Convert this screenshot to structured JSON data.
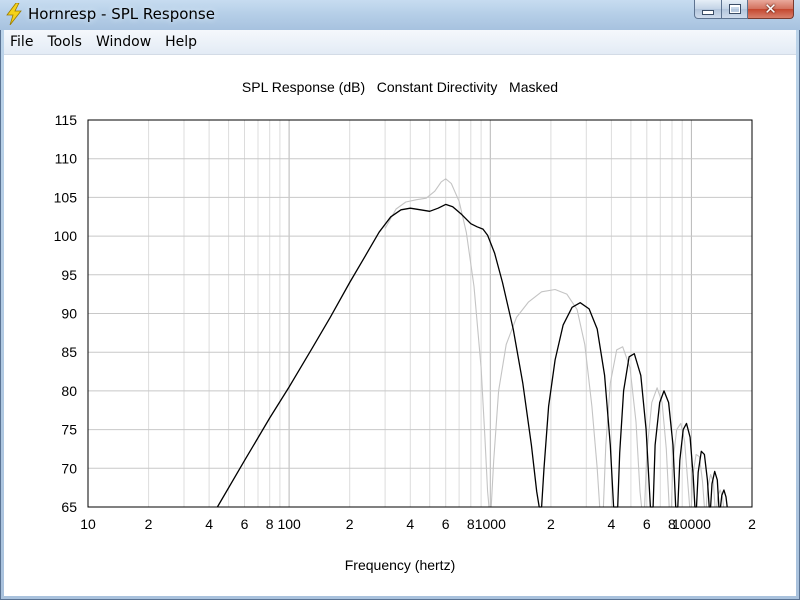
{
  "window": {
    "title": "Hornresp - SPL Response",
    "buttons": {
      "minimize": "minimize",
      "maximize": "maximize",
      "close": "✕"
    },
    "icon": "lightning-bolt-icon"
  },
  "menu": {
    "items": [
      {
        "label": "File"
      },
      {
        "label": "Tools"
      },
      {
        "label": "Window"
      },
      {
        "label": "Help"
      }
    ]
  },
  "chart_data": {
    "type": "line",
    "title": "SPL Response (dB)   Constant Directivity   Masked",
    "xlabel": "Frequency (hertz)",
    "ylabel": "",
    "x_scale": "log",
    "xlim": [
      10,
      20000
    ],
    "ylim": [
      65,
      115
    ],
    "yticks": [
      65,
      70,
      75,
      80,
      85,
      90,
      95,
      100,
      105,
      110,
      115
    ],
    "xtick_labels": [
      {
        "x": 10,
        "label": "10"
      },
      {
        "x": 20,
        "label": "2"
      },
      {
        "x": 40,
        "label": "4"
      },
      {
        "x": 60,
        "label": "6"
      },
      {
        "x": 80,
        "label": "8"
      },
      {
        "x": 100,
        "label": "100"
      },
      {
        "x": 200,
        "label": "2"
      },
      {
        "x": 400,
        "label": "4"
      },
      {
        "x": 600,
        "label": "6"
      },
      {
        "x": 800,
        "label": "8"
      },
      {
        "x": 1000,
        "label": "1000"
      },
      {
        "x": 2000,
        "label": "2"
      },
      {
        "x": 4000,
        "label": "4"
      },
      {
        "x": 6000,
        "label": "6"
      },
      {
        "x": 8000,
        "label": "8"
      },
      {
        "x": 10000,
        "label": "10000"
      },
      {
        "x": 20000,
        "label": "2"
      }
    ],
    "grid": true,
    "legend": "none",
    "series": [
      {
        "color": "#000000",
        "points": [
          [
            44,
            65
          ],
          [
            60,
            71
          ],
          [
            80,
            76.5
          ],
          [
            100,
            80.5
          ],
          [
            130,
            85.5
          ],
          [
            160,
            89.5
          ],
          [
            200,
            94
          ],
          [
            240,
            97.5
          ],
          [
            280,
            100.5
          ],
          [
            320,
            102.5
          ],
          [
            360,
            103.4
          ],
          [
            400,
            103.6
          ],
          [
            450,
            103.4
          ],
          [
            500,
            103.2
          ],
          [
            550,
            103.6
          ],
          [
            600,
            104.1
          ],
          [
            650,
            103.8
          ],
          [
            720,
            102.8
          ],
          [
            800,
            101.6
          ],
          [
            860,
            101.2
          ],
          [
            920,
            100.9
          ],
          [
            970,
            100.1
          ],
          [
            1050,
            97.8
          ],
          [
            1150,
            94
          ],
          [
            1300,
            88
          ],
          [
            1450,
            81
          ],
          [
            1600,
            73
          ],
          [
            1700,
            67
          ],
          [
            1750,
            65
          ],
          [
            1800,
            65
          ],
          [
            1850,
            70
          ],
          [
            1950,
            78
          ],
          [
            2100,
            84
          ],
          [
            2300,
            88.5
          ],
          [
            2550,
            90.8
          ],
          [
            2800,
            91.4
          ],
          [
            3100,
            90.6
          ],
          [
            3400,
            88
          ],
          [
            3700,
            82
          ],
          [
            3950,
            73
          ],
          [
            4100,
            65
          ],
          [
            4300,
            65
          ],
          [
            4400,
            72
          ],
          [
            4600,
            80
          ],
          [
            4900,
            84.4
          ],
          [
            5200,
            84.8
          ],
          [
            5600,
            82
          ],
          [
            5950,
            75
          ],
          [
            6250,
            65
          ],
          [
            6450,
            65
          ],
          [
            6600,
            73
          ],
          [
            6950,
            78.5
          ],
          [
            7300,
            80
          ],
          [
            7700,
            78.5
          ],
          [
            8100,
            73
          ],
          [
            8350,
            65
          ],
          [
            8550,
            65
          ],
          [
            8750,
            71
          ],
          [
            9100,
            75
          ],
          [
            9450,
            75.8
          ],
          [
            9850,
            74
          ],
          [
            10200,
            69
          ],
          [
            10400,
            65
          ],
          [
            10600,
            65
          ],
          [
            10800,
            69.5
          ],
          [
            11200,
            72.2
          ],
          [
            11600,
            71.8
          ],
          [
            12000,
            68.5
          ],
          [
            12250,
            65
          ],
          [
            12450,
            65
          ],
          [
            12650,
            68
          ],
          [
            13050,
            69.6
          ],
          [
            13450,
            68.5
          ],
          [
            13700,
            65
          ],
          [
            13950,
            65
          ],
          [
            14150,
            66.5
          ],
          [
            14500,
            67.2
          ],
          [
            14850,
            66.3
          ],
          [
            15050,
            65
          ]
        ]
      },
      {
        "color": "#c4c4c4",
        "points": [
          [
            300,
            101
          ],
          [
            340,
            103.5
          ],
          [
            380,
            104.4
          ],
          [
            430,
            104.7
          ],
          [
            480,
            104.9
          ],
          [
            530,
            105.8
          ],
          [
            570,
            107
          ],
          [
            600,
            107.4
          ],
          [
            640,
            106.8
          ],
          [
            700,
            104.5
          ],
          [
            760,
            100.5
          ],
          [
            830,
            93.5
          ],
          [
            900,
            83
          ],
          [
            940,
            74
          ],
          [
            970,
            67
          ],
          [
            985,
            65
          ],
          [
            1010,
            65
          ],
          [
            1040,
            71
          ],
          [
            1100,
            80
          ],
          [
            1200,
            86
          ],
          [
            1350,
            89.5
          ],
          [
            1550,
            91.5
          ],
          [
            1800,
            92.8
          ],
          [
            2100,
            93.1
          ],
          [
            2400,
            92.5
          ],
          [
            2700,
            90.5
          ],
          [
            2950,
            86
          ],
          [
            3200,
            78
          ],
          [
            3400,
            70
          ],
          [
            3500,
            65
          ],
          [
            3650,
            65
          ],
          [
            3750,
            73
          ],
          [
            3950,
            81
          ],
          [
            4250,
            85.3
          ],
          [
            4550,
            85.7
          ],
          [
            4950,
            83
          ],
          [
            5300,
            76
          ],
          [
            5550,
            67
          ],
          [
            5650,
            65
          ],
          [
            5850,
            65
          ],
          [
            6000,
            72
          ],
          [
            6350,
            78.5
          ],
          [
            6750,
            80.4
          ],
          [
            7150,
            78.5
          ],
          [
            7500,
            72.5
          ],
          [
            7750,
            65
          ],
          [
            7950,
            65
          ],
          [
            8100,
            71
          ],
          [
            8450,
            75
          ],
          [
            8850,
            75.8
          ],
          [
            9250,
            73.5
          ],
          [
            9600,
            68
          ],
          [
            9800,
            65
          ],
          [
            10000,
            65
          ],
          [
            10150,
            69
          ],
          [
            10550,
            71.8
          ],
          [
            10950,
            71.5
          ],
          [
            11350,
            68.3
          ],
          [
            11600,
            65
          ],
          [
            11850,
            65
          ],
          [
            12050,
            67.5
          ],
          [
            12450,
            69.2
          ],
          [
            12850,
            68.2
          ],
          [
            13100,
            65
          ],
          [
            13350,
            65
          ],
          [
            13550,
            66.5
          ],
          [
            13900,
            67.2
          ],
          [
            14250,
            66.3
          ],
          [
            14450,
            65
          ]
        ]
      }
    ]
  }
}
